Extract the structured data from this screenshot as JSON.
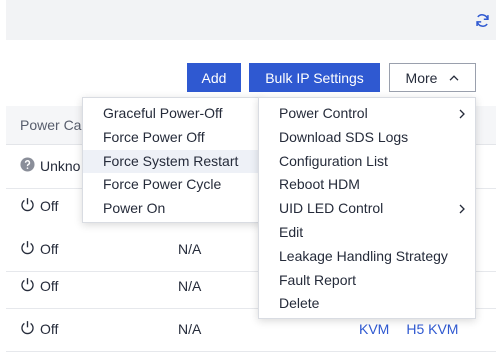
{
  "toolbar": {
    "add_label": "Add",
    "bulk_label": "Bulk IP Settings",
    "more_label": "More"
  },
  "table": {
    "header_label": "Power Ca",
    "rows": [
      {
        "state": "Unkno",
        "status_icon": "question-circle-icon",
        "na": "",
        "links": []
      },
      {
        "state": "Off",
        "status_icon": "power-icon",
        "na": "",
        "links": []
      },
      {
        "state": "Off",
        "status_icon": "power-icon",
        "na": "N/A",
        "links": []
      },
      {
        "state": "Off",
        "status_icon": "power-icon",
        "na": "N/A",
        "links": []
      },
      {
        "state": "Off",
        "status_icon": "power-icon",
        "na": "N/A",
        "links": [
          "KVM",
          "H5 KVM"
        ]
      }
    ]
  },
  "power_submenu": {
    "items": [
      "Graceful Power-Off",
      "Force Power Off",
      "Force System Restart",
      "Force Power Cycle",
      "Power On"
    ],
    "highlighted": "Force System Restart"
  },
  "more_menu": {
    "items": [
      "Power Control",
      "Download SDS Logs",
      "Configuration List",
      "Reboot HDM",
      "UID LED Control",
      "Edit",
      "Leakage Handling Strategy",
      "Fault Report",
      "Delete"
    ],
    "with_submenu": [
      "Power Control",
      "UID LED Control"
    ]
  },
  "colors": {
    "primary": "#2f59d1",
    "text": "#252b3a",
    "topbar": "#f2f3f5"
  }
}
